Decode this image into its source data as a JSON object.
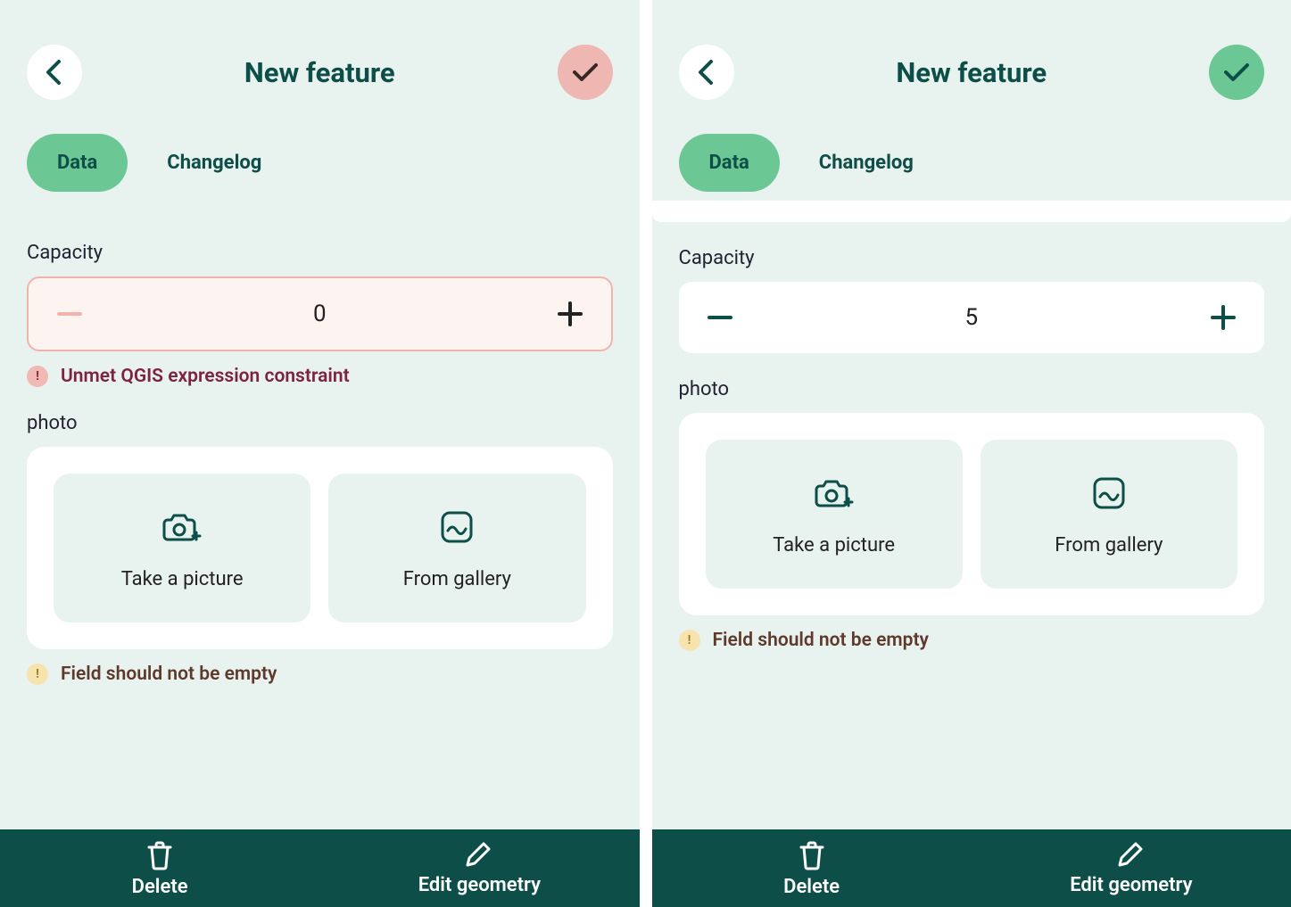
{
  "left": {
    "header_title": "New feature",
    "tabs": {
      "data": "Data",
      "changelog": "Changelog"
    },
    "capacity": {
      "label": "Capacity",
      "value": "0",
      "error": "Unmet QGIS expression constraint"
    },
    "photo": {
      "label": "photo",
      "take": "Take a picture",
      "gallery": "From gallery",
      "warning": "Field should not be empty"
    },
    "footer": {
      "delete": "Delete",
      "edit": "Edit geometry"
    }
  },
  "right": {
    "header_title": "New feature",
    "tabs": {
      "data": "Data",
      "changelog": "Changelog"
    },
    "capacity": {
      "label": "Capacity",
      "value": "5"
    },
    "photo": {
      "label": "photo",
      "take": "Take a picture",
      "gallery": "From gallery",
      "warning": "Field should not be empty"
    },
    "footer": {
      "delete": "Delete",
      "edit": "Edit geometry"
    }
  },
  "colors": {
    "bg": "#e8f2ee",
    "primary": "#0d4f48",
    "accent": "#6bc894",
    "error_bg": "#fdf3f1",
    "error_border": "#f1b3ac",
    "confirm_error": "#efb7b2"
  }
}
